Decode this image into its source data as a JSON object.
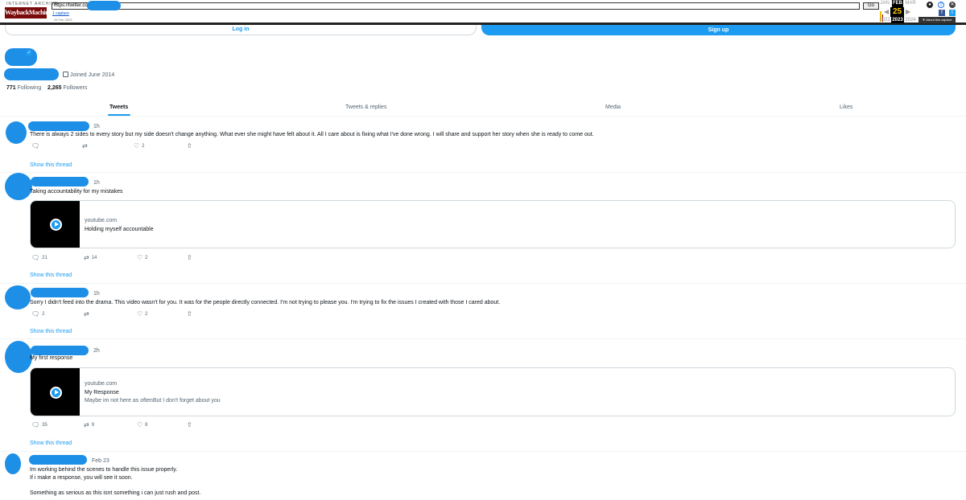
{
  "wayback": {
    "logo_top": "INTERNET ARCHIVE",
    "logo": "WaybackMachine",
    "url": "https://twitter.com",
    "go_label": "Go",
    "captures": "1 capture",
    "capture_date": "25 Feb 2023",
    "months": [
      "JAN",
      "FEB",
      "MAR"
    ],
    "day": "25",
    "years": [
      "2022",
      "2023",
      "2024"
    ],
    "about": "▼ About this capture"
  },
  "auth": {
    "login": "Log in",
    "signup": "Sign up"
  },
  "profile": {
    "joined": "Joined June 2014",
    "following_count": "771",
    "following_label": "Following",
    "followers_count": "2,265",
    "followers_label": "Followers"
  },
  "tabs": [
    "Tweets",
    "Tweets & replies",
    "Media",
    "Likes"
  ],
  "show_thread": "Show this thread",
  "tweets": [
    {
      "time": "1h",
      "text": "There is always 2 sides to every story but my side doesn't change anything. What ever she might have felt about it. All I care about is fixing what I've done wrong. I will share and support her story when she is ready to come out.",
      "replies": "",
      "retweets": "",
      "likes": "2"
    },
    {
      "time": "1h",
      "text": "Taking accountability for my mistakes",
      "card": {
        "domain": "youtube.com",
        "title": "Holding myself accountable"
      },
      "replies": "21",
      "retweets": "14",
      "likes": "2"
    },
    {
      "time": "1h",
      "text": "Sorry I didn't feed into the drama. This video wasn't for you. It was for the people directly connected. I'm not trying to please you. I'm trying to fix the issues I created with those I cared about.",
      "replies": "2",
      "retweets": "",
      "likes": "2"
    },
    {
      "time": "2h",
      "text": "My first response",
      "card": {
        "domain": "youtube.com",
        "title": "My Response",
        "desc": "Maybe im not here as oftenBut I don't forget about you"
      },
      "replies": "35",
      "retweets": "9",
      "likes": "8"
    },
    {
      "time": "Feb 23",
      "text_lines": [
        "Im working behind the scenes to handle this issue properly.",
        "If i make a response, you will see it soon.",
        "",
        "Something as serious as this isnt something i can just rush and post."
      ]
    }
  ]
}
